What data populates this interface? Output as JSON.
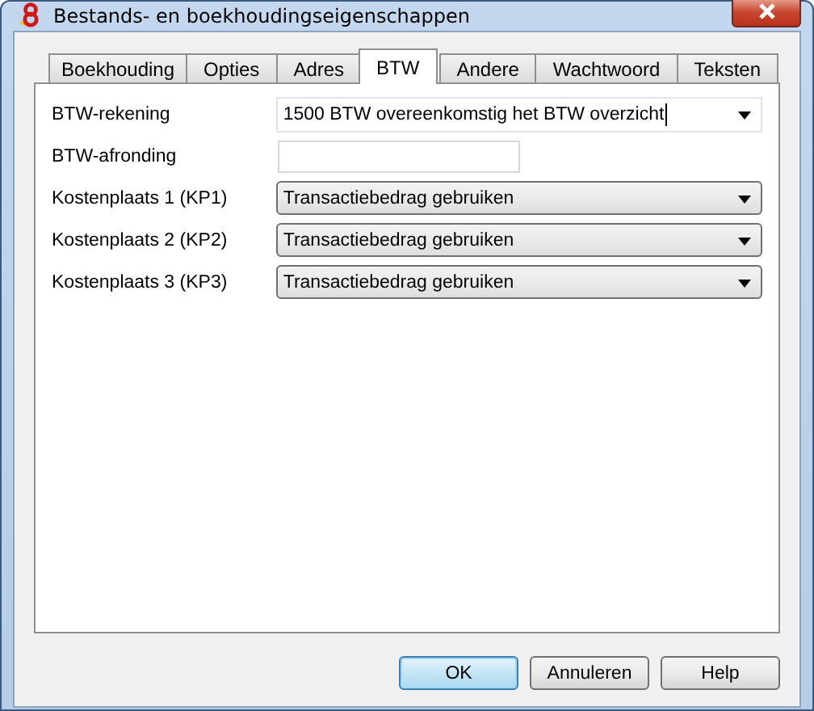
{
  "window": {
    "title": "Bestands- en boekhoudingseigenschappen"
  },
  "tabs": [
    {
      "label": "Boekhouding",
      "selected": false
    },
    {
      "label": "Opties",
      "selected": false
    },
    {
      "label": "Adres",
      "selected": false
    },
    {
      "label": "BTW",
      "selected": true
    },
    {
      "label": "Andere",
      "selected": false
    },
    {
      "label": "Wachtwoord",
      "selected": false
    },
    {
      "label": "Teksten",
      "selected": false
    }
  ],
  "fields": [
    {
      "kind": "editcombo",
      "label": "BTW-rekening",
      "value": "1500 BTW overeenkomstig het BTW overzicht"
    },
    {
      "kind": "text",
      "label": "BTW-afronding"
    },
    {
      "kind": "combo",
      "label": "Kostenplaats 1 (KP1)",
      "value": "Transactiebedrag gebruiken"
    },
    {
      "kind": "combo",
      "label": "Kostenplaats 2 (KP2)",
      "value": "Transactiebedrag gebruiken"
    },
    {
      "kind": "combo",
      "label": "Kostenplaats 3 (KP3)",
      "value": "Transactiebedrag gebruiken"
    }
  ],
  "buttons": [
    {
      "label": "OK",
      "default": true
    },
    {
      "label": "Annuleren",
      "default": false
    },
    {
      "label": "Help",
      "default": false
    }
  ]
}
